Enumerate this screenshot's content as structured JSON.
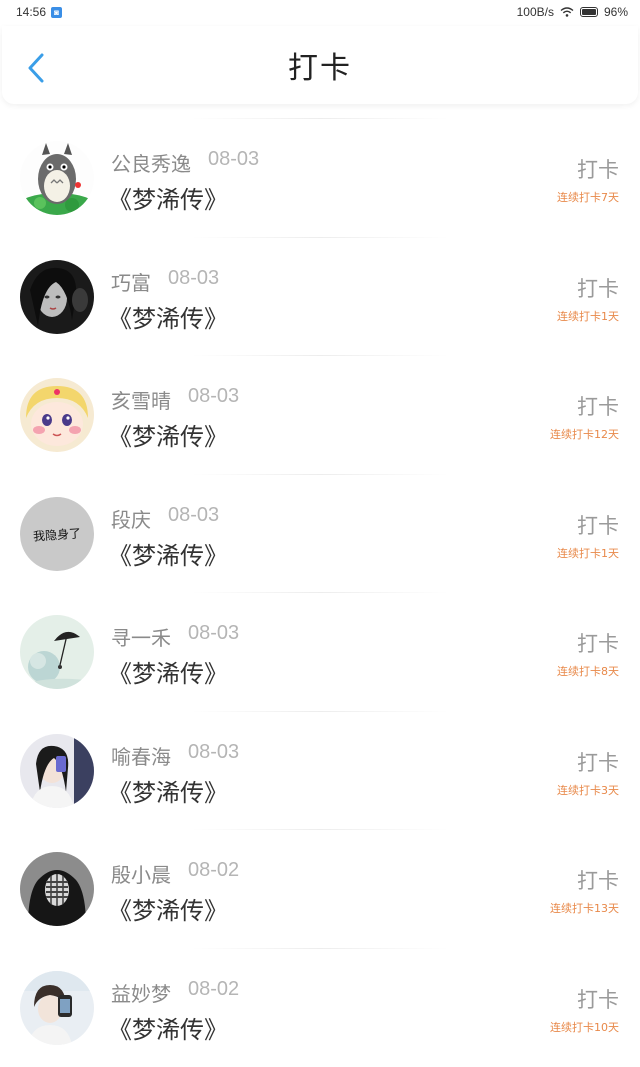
{
  "status_bar": {
    "time": "14:56",
    "app_icon": "notification-app-icon",
    "speed": "100B/s",
    "battery": "96%"
  },
  "header": {
    "title": "打卡",
    "back_icon": "chevron-left-icon",
    "accent_color": "#3a9ee8"
  },
  "streak_color": "#e8894a",
  "items": [
    {
      "name": "公良秀逸",
      "date": "08-03",
      "book": "《梦浠传》",
      "action": "打卡",
      "streak": "连续打卡7天",
      "avatar": "totoro-avatar"
    },
    {
      "name": "巧富",
      "date": "08-03",
      "book": "《梦浠传》",
      "action": "打卡",
      "streak": "连续打卡1天",
      "avatar": "dark-portrait-avatar"
    },
    {
      "name": "亥雪晴",
      "date": "08-03",
      "book": "《梦浠传》",
      "action": "打卡",
      "streak": "连续打卡12天",
      "avatar": "cartoon-girl-avatar"
    },
    {
      "name": "段庆",
      "date": "08-03",
      "book": "《梦浠传》",
      "action": "打卡",
      "streak": "连续打卡1天",
      "avatar": "text-avatar",
      "avatar_text": "我隐身了"
    },
    {
      "name": "寻一禾",
      "date": "08-03",
      "book": "《梦浠传》",
      "action": "打卡",
      "streak": "连续打卡8天",
      "avatar": "umbrella-avatar"
    },
    {
      "name": "喻春海",
      "date": "08-03",
      "book": "《梦浠传》",
      "action": "打卡",
      "streak": "连续打卡3天",
      "avatar": "selfie-avatar"
    },
    {
      "name": "殷小晨",
      "date": "08-02",
      "book": "《梦浠传》",
      "action": "打卡",
      "streak": "连续打卡13天",
      "avatar": "hooded-mask-avatar"
    },
    {
      "name": "益妙梦",
      "date": "08-02",
      "book": "《梦浠传》",
      "action": "打卡",
      "streak": "连续打卡10天",
      "avatar": "mirror-selfie-avatar"
    }
  ]
}
